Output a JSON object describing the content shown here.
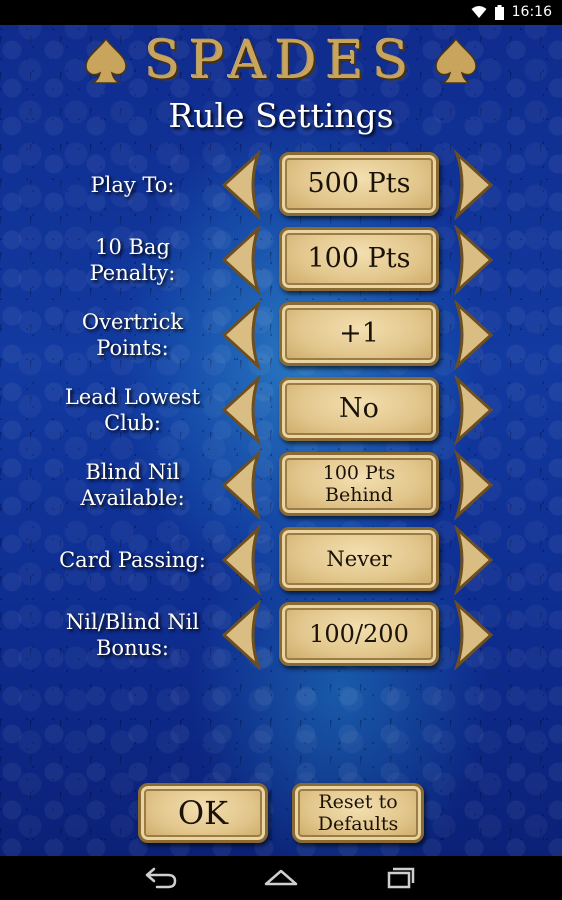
{
  "status_bar": {
    "time": "16:16"
  },
  "header": {
    "app_title": "SPADES",
    "screen_title": "Rule Settings"
  },
  "settings": [
    {
      "label": "Play To:",
      "value": "500 Pts"
    },
    {
      "label": "10 Bag\nPenalty:",
      "value": "100 Pts"
    },
    {
      "label": "Overtrick\nPoints:",
      "value": "+1"
    },
    {
      "label": "Lead Lowest\nClub:",
      "value": "No"
    },
    {
      "label": "Blind Nil\nAvailable:",
      "value": "100 Pts\nBehind"
    },
    {
      "label": "Card Passing:",
      "value": "Never"
    },
    {
      "label": "Nil/Blind Nil\nBonus:",
      "value": "100/200"
    }
  ],
  "buttons": {
    "ok": "OK",
    "reset": "Reset to\nDefaults"
  },
  "colors": {
    "gold": "#c9a45c",
    "plate": "#e2c68c",
    "background": "#123aa0"
  },
  "icons": {
    "title_left": "spade-icon",
    "title_right": "spade-icon",
    "decrement": "left-arrow-icon",
    "increment": "right-arrow-icon",
    "nav_back": "back-icon",
    "nav_home": "home-icon",
    "nav_recents": "recents-icon"
  }
}
